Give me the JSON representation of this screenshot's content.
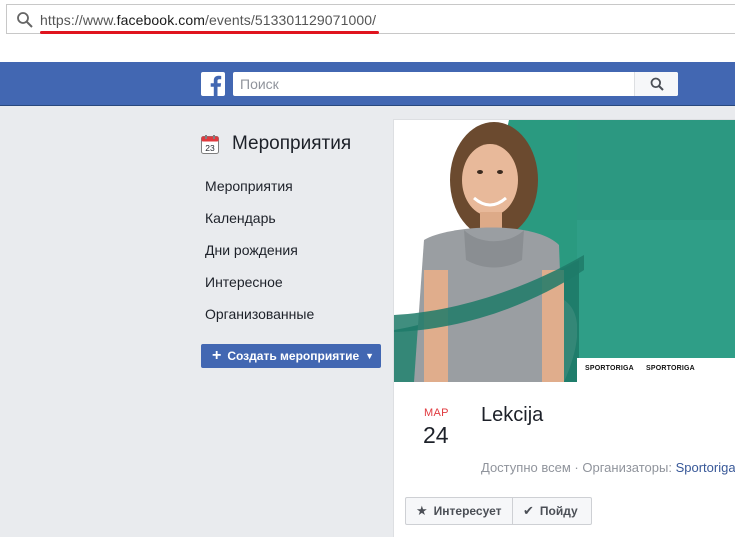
{
  "browser": {
    "url_prefix": "https://www.",
    "url_host": "facebook.com",
    "url_path": "/events/513301129071000/"
  },
  "header": {
    "logo": "f",
    "search_placeholder": "Поиск"
  },
  "sidebar": {
    "title": "Мероприятия",
    "calendar_day": "23",
    "items": [
      {
        "label": "Мероприятия"
      },
      {
        "label": "Календарь"
      },
      {
        "label": "Дни рождения"
      },
      {
        "label": "Интересное"
      },
      {
        "label": "Организованные"
      }
    ],
    "create_button": "Создать мероприятие"
  },
  "event": {
    "month": "МАР",
    "day": "24",
    "title": "Lekcija",
    "privacy": "Доступно всем",
    "organizers_label": "Организаторы:",
    "organizer": "Sportoriga",
    "cover_tags": [
      "SPORTORIGA",
      "SPORTORIGA"
    ],
    "interested_button": "Интересует",
    "going_button": "Пойду"
  },
  "colors": {
    "fb_blue": "#4267b2",
    "date_red": "#e0393e",
    "url_underline": "#e0141e",
    "cover_green": "#2a9a80"
  },
  "icons": [
    "search-icon",
    "facebook-logo-icon",
    "calendar-icon",
    "plus-icon",
    "caret-down-icon",
    "star-icon",
    "check-icon"
  ]
}
